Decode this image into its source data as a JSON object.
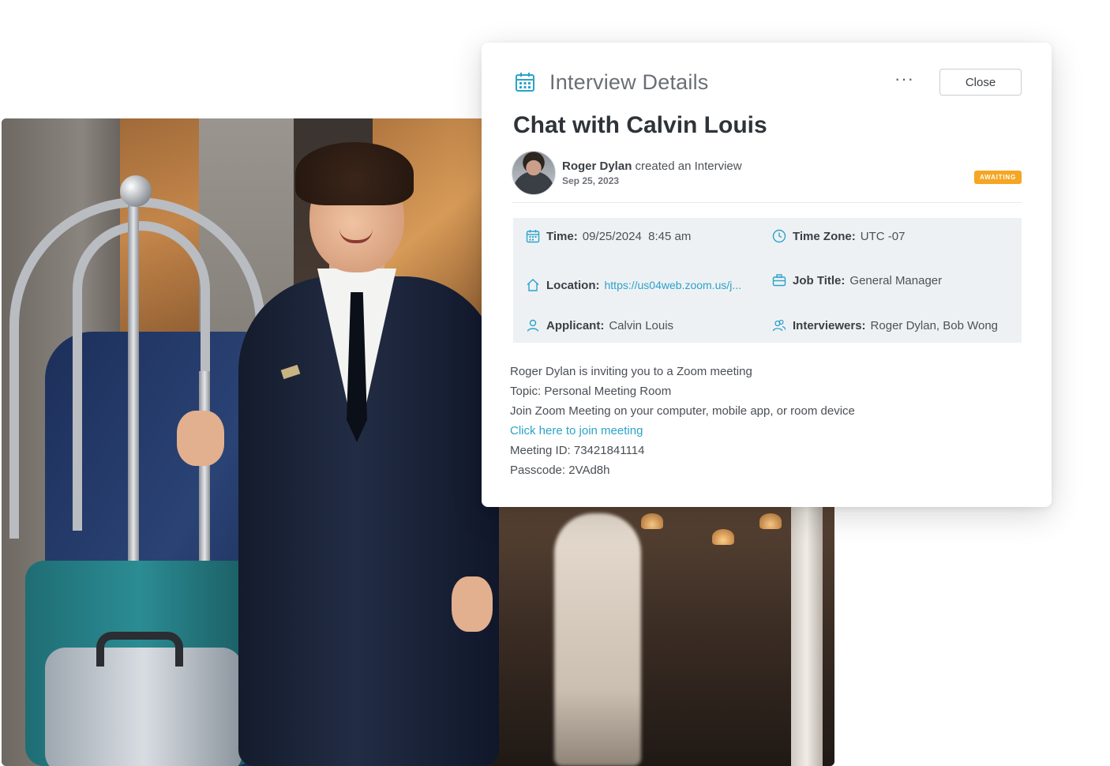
{
  "card": {
    "title": "Interview Details",
    "more_label": "···",
    "close_label": "Close"
  },
  "interview": {
    "title": "Chat with Calvin Louis",
    "creator": {
      "name": "Roger Dylan",
      "action": " created an Interview",
      "date": "Sep 25, 2023"
    },
    "status": "AWAITING"
  },
  "details": {
    "time": {
      "label": "Time:",
      "value": "09/25/2024  8:45 am"
    },
    "timezone": {
      "label": "Time Zone:",
      "value": "UTC -07"
    },
    "location": {
      "label": "Location:",
      "value": "https://us04web.zoom.us/j..."
    },
    "job_title": {
      "label": "Job Title:",
      "value": "General Manager"
    },
    "applicant": {
      "label": "Applicant:",
      "value": "Calvin Louis"
    },
    "interviewers": {
      "label": "Interviewers:",
      "value": "Roger Dylan, Bob Wong"
    }
  },
  "invitation": {
    "line1": "Roger Dylan is inviting you to a Zoom meeting",
    "line2": "Topic: Personal Meeting Room",
    "line3": "Join Zoom Meeting on your computer, mobile app, or room device",
    "join_link": "Click here to join meeting",
    "meeting_id": "Meeting ID: 73421841114",
    "passcode": "Passcode: 2VAd8h"
  },
  "colors": {
    "accent": "#2ba3c9",
    "badge": "#f5a623",
    "panel": "#eef1f4"
  },
  "icons": {
    "header": "calendar-icon",
    "time": "calendar-icon",
    "timezone": "clock-icon",
    "location": "home-icon",
    "job_title": "briefcase-icon",
    "applicant": "user-icon",
    "interviewers": "users-icon"
  }
}
